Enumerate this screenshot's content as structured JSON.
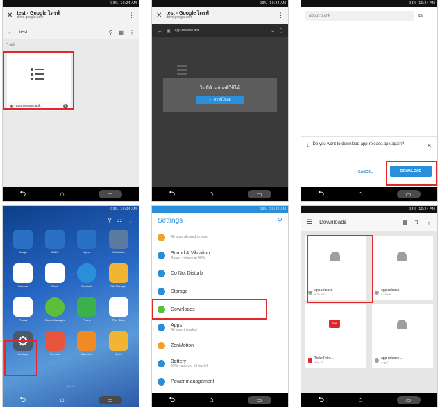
{
  "colors": {
    "highlight": "#e1262c",
    "drive_bar": "#f2f2f2",
    "settings_green": "#5bbf3c",
    "accent_blue": "#2a8fd8"
  },
  "statusbar": {
    "time": "10:24 AM",
    "battery": "93%"
  },
  "p1": {
    "title": "test - Google ไดรฟ์",
    "subtitle": "drive.google.com",
    "folder": "test",
    "section": "ไฟล์",
    "file_name": "app-release.apk"
  },
  "p2": {
    "title": "test - Google ไดรฟ์",
    "subtitle": "drive.google.com",
    "file_name": "app-release.apk",
    "dialog_text": "ไม่มีตัวอย่างที่ใช้ได้",
    "download_label": "ดาวน์โหลด"
  },
  "p3": {
    "url": "about:blank",
    "prompt": "Do you want to download app-release.apk again?",
    "cancel": "CANCEL",
    "download": "DOWNLOAD"
  },
  "p4": {
    "apps": [
      {
        "label": "Google",
        "icon": "google-folder-icon"
      },
      {
        "label": "ASUS",
        "icon": "asus-folder-icon"
      },
      {
        "label": "Apps",
        "icon": "apps-folder-icon"
      },
      {
        "label": "Calculator",
        "icon": "calculator-icon"
      },
      {
        "label": "Camera",
        "icon": "camera-icon"
      },
      {
        "label": "Clock",
        "icon": "clock-icon"
      },
      {
        "label": "Contacts",
        "icon": "contacts-icon"
      },
      {
        "label": "File Manager",
        "icon": "folder-icon"
      },
      {
        "label": "Photos",
        "icon": "photos-icon"
      },
      {
        "label": "Mobile Manager",
        "icon": "bolt-icon"
      },
      {
        "label": "Phone",
        "icon": "phone-icon"
      },
      {
        "label": "Play Store",
        "icon": "play-store-icon"
      },
      {
        "label": "Settings",
        "icon": "gear-icon"
      },
      {
        "label": "Themes",
        "icon": "themes-icon"
      },
      {
        "label": "Calendar",
        "icon": "calendar-icon"
      },
      {
        "label": "Docs",
        "icon": "docs-icon"
      }
    ]
  },
  "p5": {
    "title": "Settings",
    "items": [
      {
        "label": "",
        "sub": "All apps allowed to send",
        "color": "#f2a02e"
      },
      {
        "label": "Sound & Vibration",
        "sub": "Ringer volume at 40%",
        "color": "#2a8fd8"
      },
      {
        "label": "Do Not Disturb",
        "sub": "",
        "color": "#2a8fd8"
      },
      {
        "label": "Storage",
        "sub": "",
        "color": "#2a8fd8"
      },
      {
        "label": "Downloads",
        "sub": "",
        "color": "#5bbf3c"
      },
      {
        "label": "Apps",
        "sub": "All apps installed",
        "color": "#2a8fd8"
      },
      {
        "label": "ZenMotion",
        "sub": "",
        "color": "#f2a02e"
      },
      {
        "label": "Battery",
        "sub": "99% - approx. 15 hrs left",
        "color": "#2a8fd8"
      },
      {
        "label": "Power management",
        "sub": "",
        "color": "#2a8fd8"
      }
    ]
  },
  "p6": {
    "title": "Downloads",
    "items": [
      {
        "name": "app-release ...",
        "meta": "9:20 AM",
        "icon": "android-icon"
      },
      {
        "name": "app-release ...",
        "meta": "9:18 AM",
        "icon": "android-icon"
      },
      {
        "name": "TicketPrint...",
        "meta": "Aug 21",
        "icon": "pdf-icon"
      },
      {
        "name": "app-release ...",
        "meta": "Aug 21",
        "icon": "android-icon"
      }
    ]
  }
}
